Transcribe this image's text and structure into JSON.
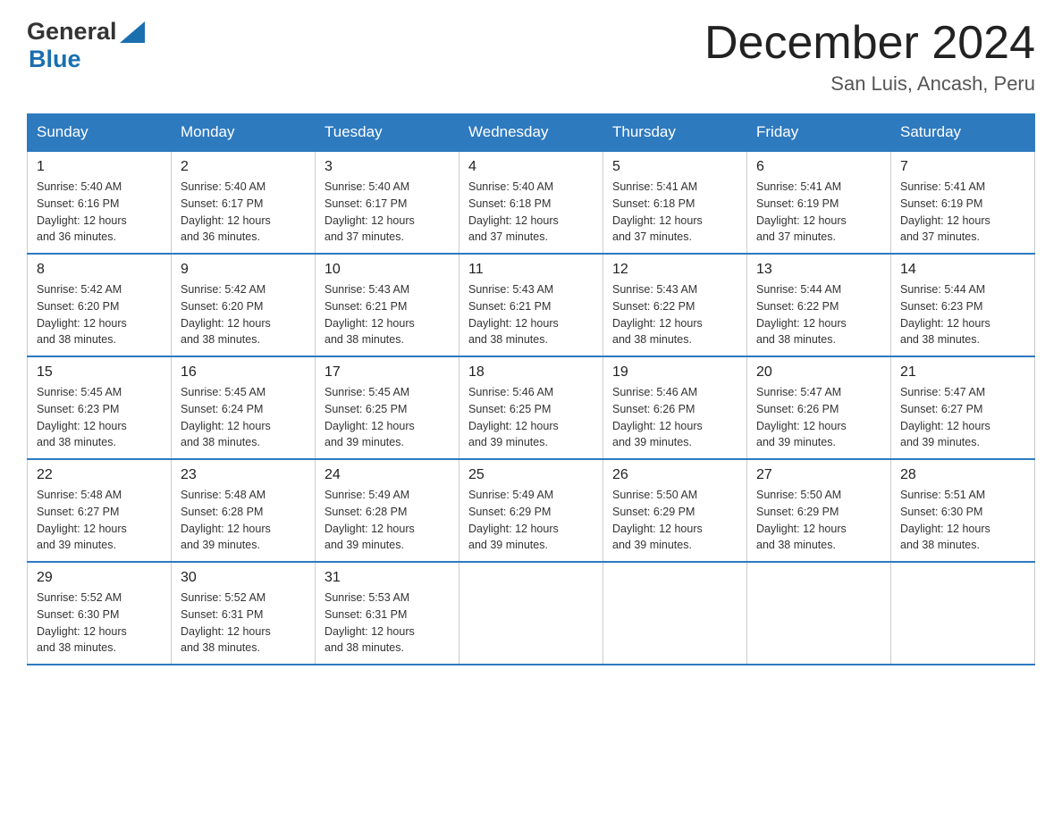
{
  "header": {
    "logo_general": "General",
    "logo_blue": "Blue",
    "month_title": "December 2024",
    "location": "San Luis, Ancash, Peru"
  },
  "days_of_week": [
    "Sunday",
    "Monday",
    "Tuesday",
    "Wednesday",
    "Thursday",
    "Friday",
    "Saturday"
  ],
  "weeks": [
    [
      {
        "day": "1",
        "info": "Sunrise: 5:40 AM\nSunset: 6:16 PM\nDaylight: 12 hours\nand 36 minutes."
      },
      {
        "day": "2",
        "info": "Sunrise: 5:40 AM\nSunset: 6:17 PM\nDaylight: 12 hours\nand 36 minutes."
      },
      {
        "day": "3",
        "info": "Sunrise: 5:40 AM\nSunset: 6:17 PM\nDaylight: 12 hours\nand 37 minutes."
      },
      {
        "day": "4",
        "info": "Sunrise: 5:40 AM\nSunset: 6:18 PM\nDaylight: 12 hours\nand 37 minutes."
      },
      {
        "day": "5",
        "info": "Sunrise: 5:41 AM\nSunset: 6:18 PM\nDaylight: 12 hours\nand 37 minutes."
      },
      {
        "day": "6",
        "info": "Sunrise: 5:41 AM\nSunset: 6:19 PM\nDaylight: 12 hours\nand 37 minutes."
      },
      {
        "day": "7",
        "info": "Sunrise: 5:41 AM\nSunset: 6:19 PM\nDaylight: 12 hours\nand 37 minutes."
      }
    ],
    [
      {
        "day": "8",
        "info": "Sunrise: 5:42 AM\nSunset: 6:20 PM\nDaylight: 12 hours\nand 38 minutes."
      },
      {
        "day": "9",
        "info": "Sunrise: 5:42 AM\nSunset: 6:20 PM\nDaylight: 12 hours\nand 38 minutes."
      },
      {
        "day": "10",
        "info": "Sunrise: 5:43 AM\nSunset: 6:21 PM\nDaylight: 12 hours\nand 38 minutes."
      },
      {
        "day": "11",
        "info": "Sunrise: 5:43 AM\nSunset: 6:21 PM\nDaylight: 12 hours\nand 38 minutes."
      },
      {
        "day": "12",
        "info": "Sunrise: 5:43 AM\nSunset: 6:22 PM\nDaylight: 12 hours\nand 38 minutes."
      },
      {
        "day": "13",
        "info": "Sunrise: 5:44 AM\nSunset: 6:22 PM\nDaylight: 12 hours\nand 38 minutes."
      },
      {
        "day": "14",
        "info": "Sunrise: 5:44 AM\nSunset: 6:23 PM\nDaylight: 12 hours\nand 38 minutes."
      }
    ],
    [
      {
        "day": "15",
        "info": "Sunrise: 5:45 AM\nSunset: 6:23 PM\nDaylight: 12 hours\nand 38 minutes."
      },
      {
        "day": "16",
        "info": "Sunrise: 5:45 AM\nSunset: 6:24 PM\nDaylight: 12 hours\nand 38 minutes."
      },
      {
        "day": "17",
        "info": "Sunrise: 5:45 AM\nSunset: 6:25 PM\nDaylight: 12 hours\nand 39 minutes."
      },
      {
        "day": "18",
        "info": "Sunrise: 5:46 AM\nSunset: 6:25 PM\nDaylight: 12 hours\nand 39 minutes."
      },
      {
        "day": "19",
        "info": "Sunrise: 5:46 AM\nSunset: 6:26 PM\nDaylight: 12 hours\nand 39 minutes."
      },
      {
        "day": "20",
        "info": "Sunrise: 5:47 AM\nSunset: 6:26 PM\nDaylight: 12 hours\nand 39 minutes."
      },
      {
        "day": "21",
        "info": "Sunrise: 5:47 AM\nSunset: 6:27 PM\nDaylight: 12 hours\nand 39 minutes."
      }
    ],
    [
      {
        "day": "22",
        "info": "Sunrise: 5:48 AM\nSunset: 6:27 PM\nDaylight: 12 hours\nand 39 minutes."
      },
      {
        "day": "23",
        "info": "Sunrise: 5:48 AM\nSunset: 6:28 PM\nDaylight: 12 hours\nand 39 minutes."
      },
      {
        "day": "24",
        "info": "Sunrise: 5:49 AM\nSunset: 6:28 PM\nDaylight: 12 hours\nand 39 minutes."
      },
      {
        "day": "25",
        "info": "Sunrise: 5:49 AM\nSunset: 6:29 PM\nDaylight: 12 hours\nand 39 minutes."
      },
      {
        "day": "26",
        "info": "Sunrise: 5:50 AM\nSunset: 6:29 PM\nDaylight: 12 hours\nand 39 minutes."
      },
      {
        "day": "27",
        "info": "Sunrise: 5:50 AM\nSunset: 6:29 PM\nDaylight: 12 hours\nand 38 minutes."
      },
      {
        "day": "28",
        "info": "Sunrise: 5:51 AM\nSunset: 6:30 PM\nDaylight: 12 hours\nand 38 minutes."
      }
    ],
    [
      {
        "day": "29",
        "info": "Sunrise: 5:52 AM\nSunset: 6:30 PM\nDaylight: 12 hours\nand 38 minutes."
      },
      {
        "day": "30",
        "info": "Sunrise: 5:52 AM\nSunset: 6:31 PM\nDaylight: 12 hours\nand 38 minutes."
      },
      {
        "day": "31",
        "info": "Sunrise: 5:53 AM\nSunset: 6:31 PM\nDaylight: 12 hours\nand 38 minutes."
      },
      {
        "day": "",
        "info": ""
      },
      {
        "day": "",
        "info": ""
      },
      {
        "day": "",
        "info": ""
      },
      {
        "day": "",
        "info": ""
      }
    ]
  ]
}
